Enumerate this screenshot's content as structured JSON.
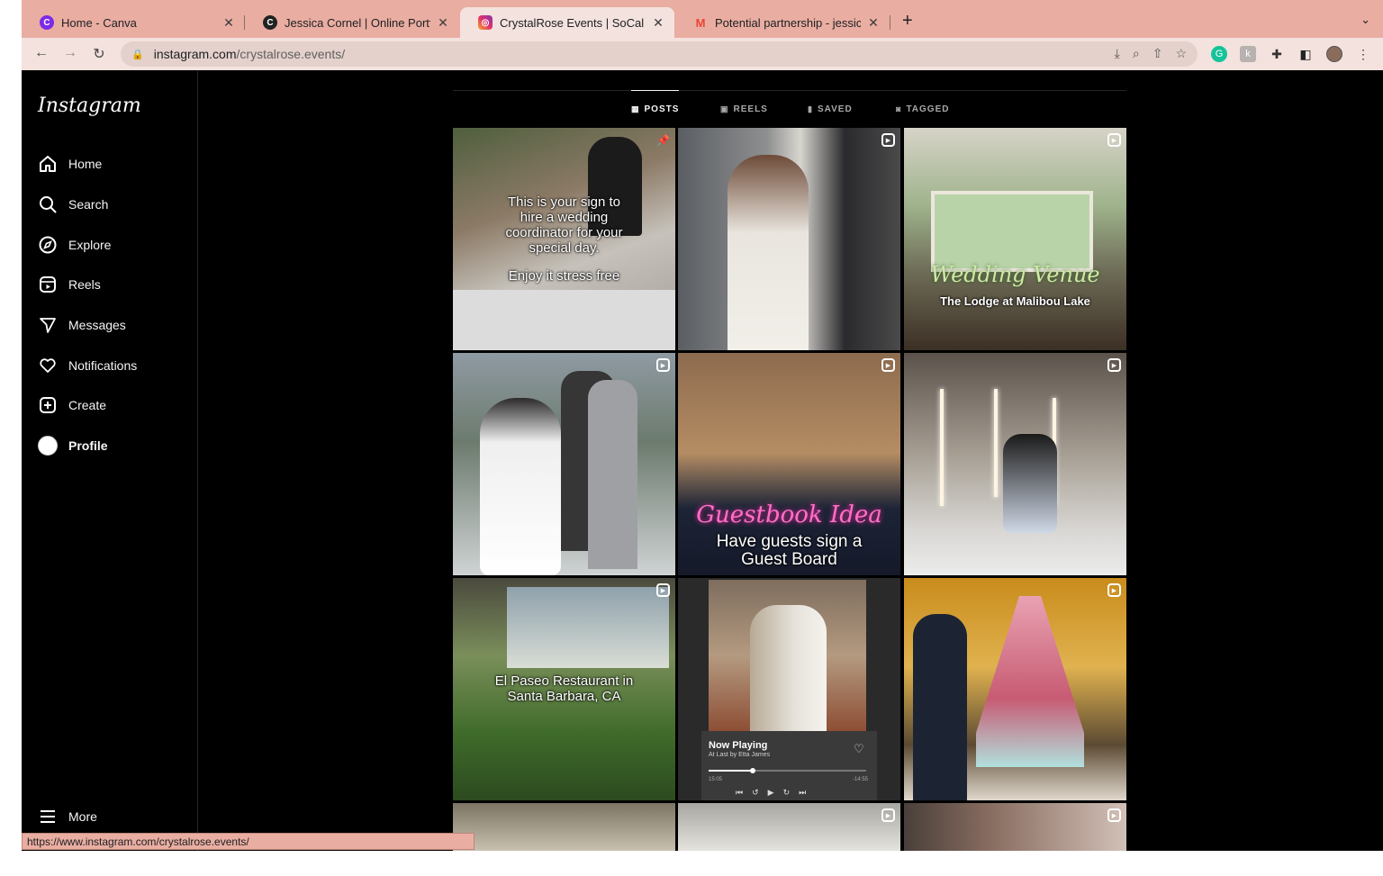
{
  "browser": {
    "tabs": [
      {
        "title": "Home - Canva",
        "icon": "canva-icon",
        "color": "#7d2ae8"
      },
      {
        "title": "Jessica Cornel | Online Portfolio",
        "icon": "portfolio-icon",
        "color": "#222222"
      },
      {
        "title": "CrystalRose Events | SoCal We",
        "icon": "instagram-icon",
        "color": "#e1306c"
      },
      {
        "title": "Potential partnership - jessica.",
        "icon": "gmail-icon",
        "color": "#ea4335"
      }
    ],
    "url_domain": "instagram.com",
    "url_path": "/crystalrose.events/",
    "status_url": "https://www.instagram.com/crystalrose.events/"
  },
  "sidebar": {
    "logo": "Instagram",
    "items": [
      {
        "label": "Home",
        "icon": "home-icon"
      },
      {
        "label": "Search",
        "icon": "search-icon"
      },
      {
        "label": "Explore",
        "icon": "compass-icon"
      },
      {
        "label": "Reels",
        "icon": "reels-icon"
      },
      {
        "label": "Messages",
        "icon": "send-icon"
      },
      {
        "label": "Notifications",
        "icon": "heart-icon"
      },
      {
        "label": "Create",
        "icon": "plus-square-icon"
      },
      {
        "label": "Profile",
        "icon": "avatar"
      }
    ],
    "more": "More"
  },
  "profile_tabs": [
    {
      "label": "POSTS",
      "icon": "grid-icon"
    },
    {
      "label": "REELS",
      "icon": "reels-icon"
    },
    {
      "label": "SAVED",
      "icon": "bookmark-icon"
    },
    {
      "label": "TAGGED",
      "icon": "tag-icon"
    }
  ],
  "posts": [
    {
      "caption": "This is your sign to hire a wedding coordinator for your special day.",
      "caption2": "Enjoy it stress free",
      "badge": "pin-icon"
    },
    {
      "caption": "",
      "badge": "reel-icon"
    },
    {
      "caption": "Wedding Venue",
      "caption2": "The Lodge at Malibou Lake",
      "badge": "reel-icon"
    },
    {
      "caption": "",
      "badge": "reel-icon"
    },
    {
      "caption": "Guestbook Idea",
      "caption2": "Have guests sign a Guest Board",
      "badge": "reel-icon"
    },
    {
      "caption": "",
      "badge": "reel-icon"
    },
    {
      "caption": "El Paseo Restaurant in Santa Barbara, CA",
      "badge": "reel-icon"
    },
    {
      "caption": "Now Playing",
      "caption2": "At Last by Etta James",
      "time_start": "15:05",
      "time_end": "-14:55",
      "badge": ""
    },
    {
      "caption": "",
      "badge": "reel-icon"
    },
    {
      "caption": "",
      "badge": ""
    },
    {
      "caption": "",
      "badge": "reel-icon"
    },
    {
      "caption": "",
      "badge": "reel-icon"
    }
  ]
}
